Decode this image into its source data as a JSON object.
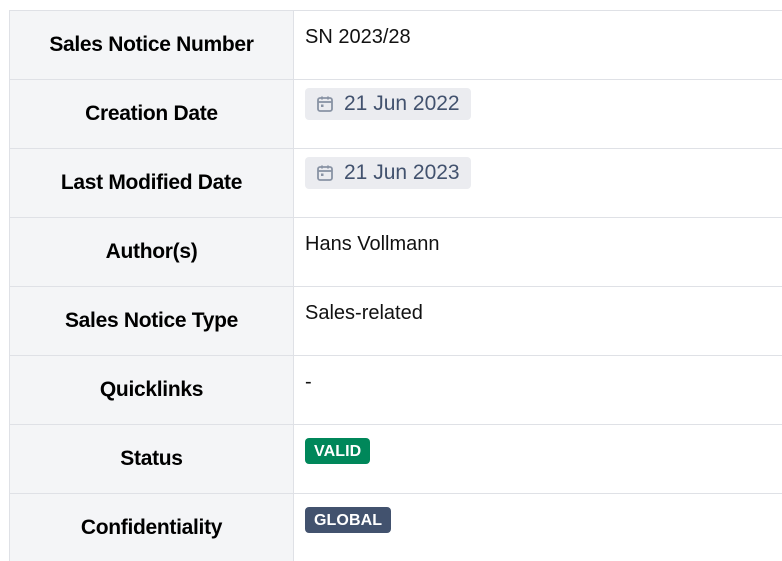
{
  "properties": [
    {
      "label": "Sales Notice Number",
      "value": "SN 2023/28",
      "kind": "text"
    },
    {
      "label": "Creation Date",
      "value": "21 Jun 2022",
      "kind": "date",
      "icon": "calendar-icon"
    },
    {
      "label": "Last Modified Date",
      "value": "21 Jun 2023",
      "kind": "date",
      "icon": "calendar-icon"
    },
    {
      "label": "Author(s)",
      "value": "Hans Vollmann",
      "kind": "text"
    },
    {
      "label": "Sales Notice Type",
      "value": "Sales-related",
      "kind": "text"
    },
    {
      "label": "Quicklinks",
      "value": "-",
      "kind": "text"
    },
    {
      "label": "Status",
      "value": "VALID",
      "kind": "lozenge",
      "color": "#00875a"
    },
    {
      "label": "Confidentiality",
      "value": "GLOBAL",
      "kind": "lozenge",
      "color": "#42526e"
    }
  ],
  "colors": {
    "header_bg": "#f4f5f7",
    "border": "#dfe1e6",
    "date_bg": "#ebecf0",
    "date_text": "#42526e",
    "status_valid": "#00875a",
    "confidentiality_global": "#42526e"
  }
}
